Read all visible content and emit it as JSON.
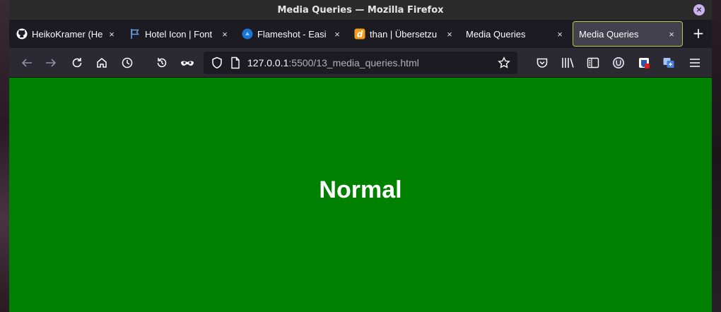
{
  "window": {
    "title": "Media Queries — Mozilla Firefox",
    "close_glyph": "×"
  },
  "tabs": [
    {
      "label": "HeikoKramer (He",
      "icon": "github-icon",
      "close": "×"
    },
    {
      "label": "Hotel Icon | Font",
      "icon": "flag-icon",
      "close": "×"
    },
    {
      "label": "Flameshot - Easi",
      "icon": "flameshot-icon",
      "close": "×"
    },
    {
      "label": "than | Übersetzu",
      "icon": "dict-icon",
      "close": "×"
    },
    {
      "label": "Media Queries",
      "icon": "none",
      "close": "×"
    },
    {
      "label": "Media Queries",
      "icon": "none",
      "close": "×",
      "active": true
    }
  ],
  "newtab_label": "+",
  "url": {
    "host": "127.0.0.1",
    "path": ":5500/13_media_queries.html"
  },
  "page": {
    "heading": "Normal",
    "background": "#008000"
  },
  "colors": {
    "accent_tab_border": "#b8c74a",
    "toolbar": "#2b2a33",
    "tabstrip": "#1c1b22"
  }
}
